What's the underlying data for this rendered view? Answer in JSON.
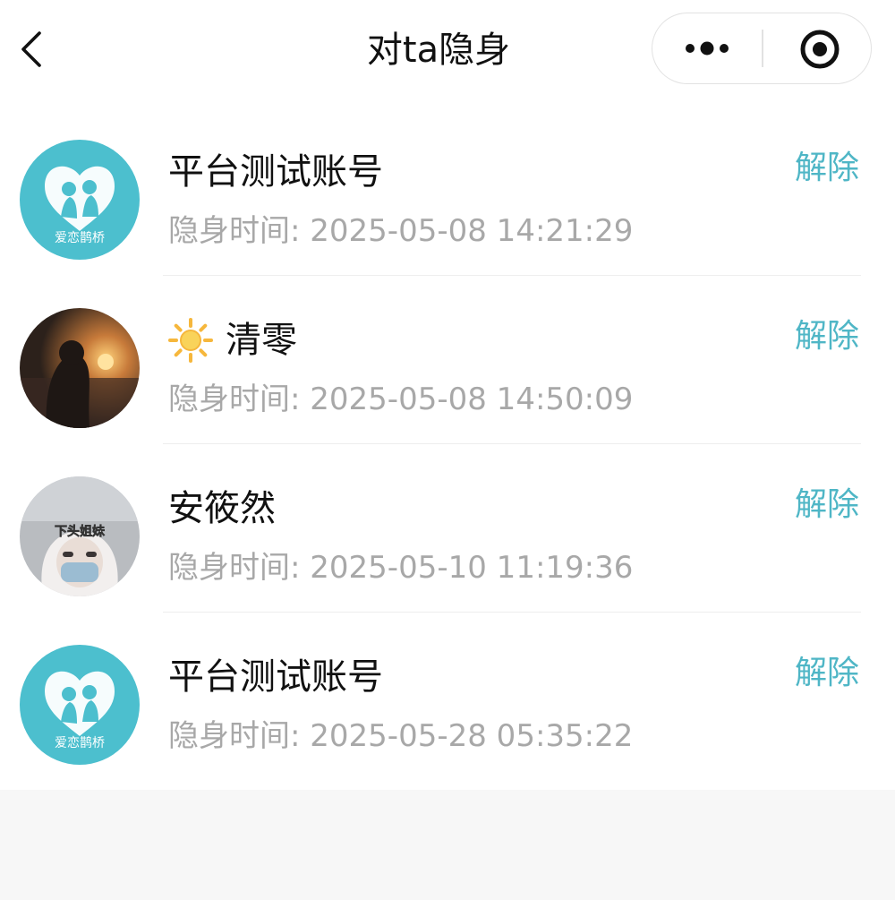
{
  "header": {
    "title": "对ta隐身"
  },
  "colors": {
    "accent": "#4fb6c6",
    "avatar_brand": "#4cbfce",
    "secondary_text": "#a8a8a8"
  },
  "list": {
    "items": [
      {
        "name": "平台测试账号",
        "time_label": "隐身时间:",
        "time_value": "2025-05-08 14:21:29",
        "action_label": "解除",
        "avatar_caption": "爱恋鹊桥"
      },
      {
        "name": "清零",
        "name_icon": "sun-emoji-icon",
        "time_label": "隐身时间:",
        "time_value": "2025-05-08 14:50:09",
        "action_label": "解除"
      },
      {
        "name": "安筱然",
        "time_label": "隐身时间:",
        "time_value": "2025-05-10 11:19:36",
        "action_label": "解除",
        "avatar_caption": "下头姐妹"
      },
      {
        "name": "平台测试账号",
        "time_label": "隐身时间:",
        "time_value": "2025-05-28 05:35:22",
        "action_label": "解除",
        "avatar_caption": "爱恋鹊桥"
      }
    ]
  }
}
